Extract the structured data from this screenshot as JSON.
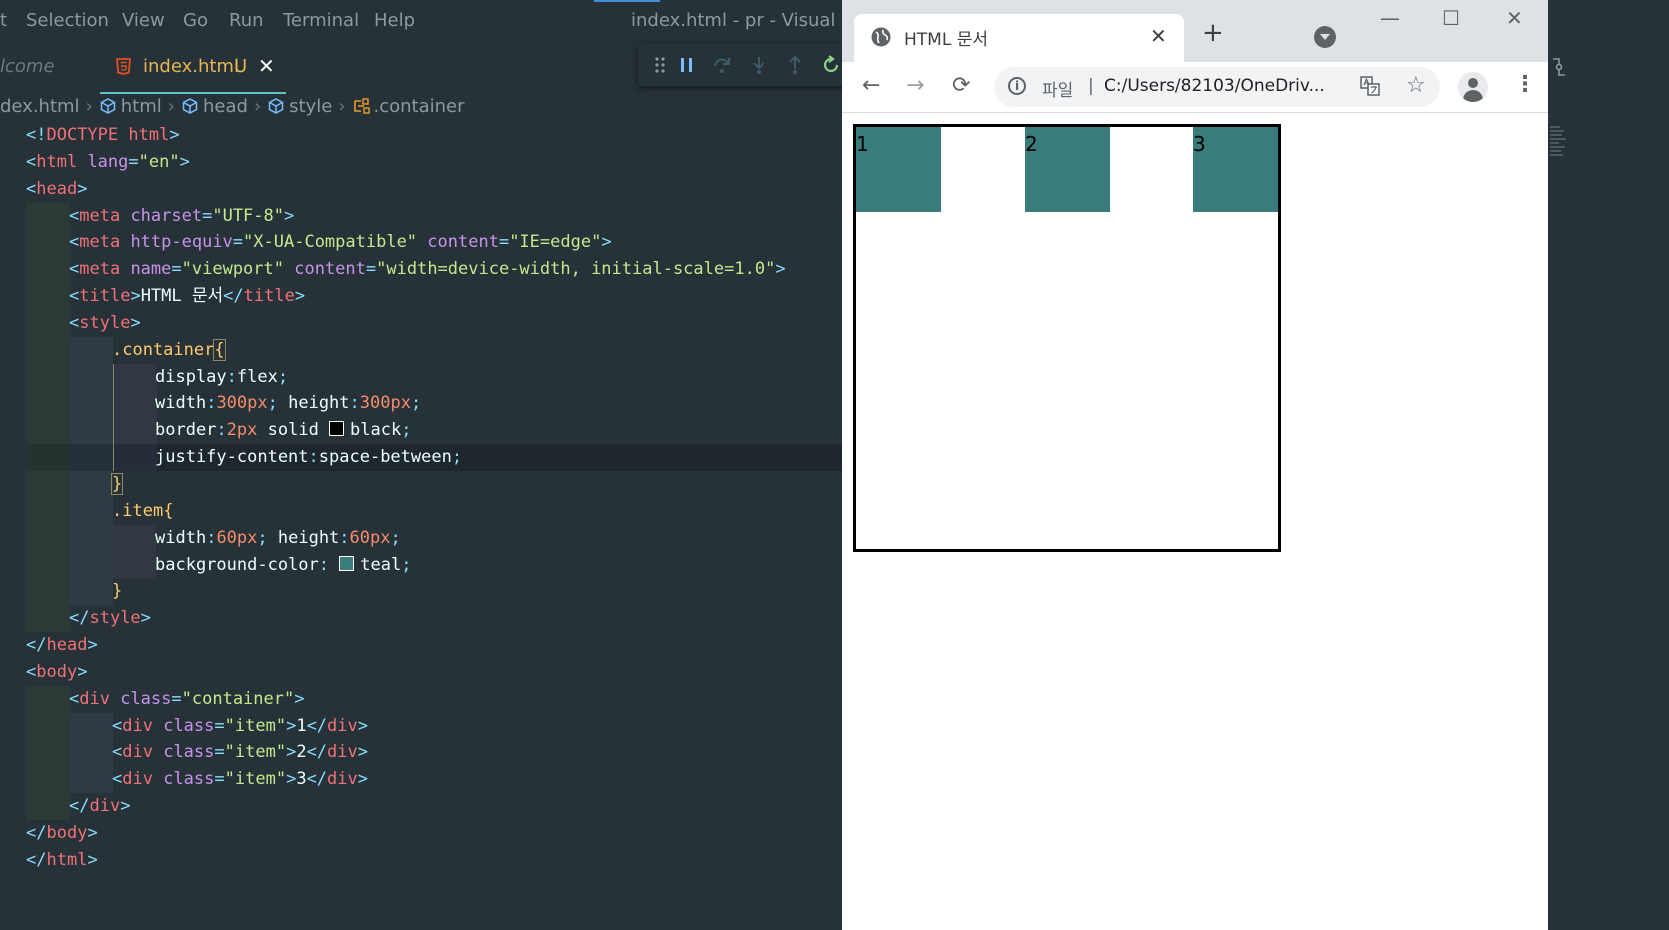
{
  "vscode": {
    "menu": [
      "t",
      "Selection",
      "View",
      "Go",
      "Run",
      "Terminal",
      "Help"
    ],
    "window_title": "index.html - pr - Visual Studi",
    "tabs": {
      "welcome": "lcome",
      "active": "index.html",
      "active_status": "U",
      "close": "✕"
    },
    "breadcrumb": [
      "dex.html",
      "html",
      "head",
      "style",
      ".container"
    ],
    "debug_icons": [
      "drag-handle-icon",
      "pause-icon",
      "step-over-icon",
      "step-into-icon",
      "step-out-icon",
      "restart-icon"
    ],
    "code": {
      "l1": {
        "a": "<!",
        "b": "DOCTYPE",
        "c": " html",
        "d": ">"
      },
      "l2": {
        "a": "<",
        "b": "html",
        "c": " lang",
        "d": "=",
        "e": "\"en\"",
        "f": ">"
      },
      "l3": {
        "a": "<",
        "b": "head",
        "c": ">"
      },
      "l4": {
        "a": "<",
        "b": "meta",
        "c": " charset",
        "d": "=",
        "e": "\"UTF-8\"",
        "f": ">"
      },
      "l5": {
        "a": "<",
        "b": "meta",
        "c": " http-equiv",
        "d": "=",
        "e": "\"X-UA-Compatible\"",
        "f": " content",
        "g": "=",
        "h": "\"IE=edge\"",
        "i": ">"
      },
      "l6": {
        "a": "<",
        "b": "meta",
        "c": " name",
        "d": "=",
        "e": "\"viewport\"",
        "f": " content",
        "g": "=",
        "h": "\"width=device-width, initial-scale=1.0\"",
        "i": ">"
      },
      "l7": {
        "a": "<",
        "b": "title",
        "c": ">",
        "d": "HTML 문서",
        "e": "</",
        "f": "title",
        "g": ">"
      },
      "l8": {
        "a": "<",
        "b": "style",
        "c": ">"
      },
      "l9": {
        "a": ".container",
        "b": "{"
      },
      "l10": {
        "a": "display",
        "b": ":",
        "c": "flex",
        "d": ";"
      },
      "l11": {
        "a": "width",
        "b": ":",
        "c": "300px",
        "d": "; ",
        "e": "height",
        "f": ":",
        "g": "300px",
        "h": ";"
      },
      "l12": {
        "a": "border",
        "b": ":",
        "c": "2px",
        "d": " solid ",
        "e": "black",
        "f": ";"
      },
      "l13": {
        "a": "justify-content",
        "b": ":",
        "c": "space-between",
        "d": ";"
      },
      "l14": {
        "a": "}"
      },
      "l15": {
        "a": ".item",
        "b": "{"
      },
      "l16": {
        "a": "width",
        "b": ":",
        "c": "60px",
        "d": "; ",
        "e": "height",
        "f": ":",
        "g": "60px",
        "h": ";"
      },
      "l17": {
        "a": "background-color",
        "b": ": ",
        "c": "teal",
        "d": ";"
      },
      "l18": {
        "a": "}"
      },
      "l19": {
        "a": "</",
        "b": "style",
        "c": ">"
      },
      "l20": {
        "a": "</",
        "b": "head",
        "c": ">"
      },
      "l21": {
        "a": "<",
        "b": "body",
        "c": ">"
      },
      "l22": {
        "a": "<",
        "b": "div",
        "c": " class",
        "d": "=",
        "e": "\"container\"",
        "f": ">"
      },
      "l23": {
        "a": "<",
        "b": "div",
        "c": " class",
        "d": "=",
        "e": "\"item\"",
        "f": ">",
        "g": "1",
        "h": "</",
        "i": "div",
        "j": ">"
      },
      "l24": {
        "a": "<",
        "b": "div",
        "c": " class",
        "d": "=",
        "e": "\"item\"",
        "f": ">",
        "g": "2",
        "h": "</",
        "i": "div",
        "j": ">"
      },
      "l25": {
        "a": "<",
        "b": "div",
        "c": " class",
        "d": "=",
        "e": "\"item\"",
        "f": ">",
        "g": "3",
        "h": "</",
        "i": "div",
        "j": ">"
      },
      "l26": {
        "a": "</",
        "b": "div",
        "c": ">"
      },
      "l27": {
        "a": "</",
        "b": "body",
        "c": ">"
      },
      "l28": {
        "a": "</",
        "b": "html",
        "c": ">"
      }
    },
    "colors": {
      "bg": "#263238",
      "tag": "#f07178",
      "attr": "#c792ea",
      "string": "#c3e88d",
      "number": "#f78c6c",
      "teal_swatch": "#008080",
      "black_swatch": "#000000"
    }
  },
  "browser": {
    "tab_title": "HTML 문서",
    "tab_close": "✕",
    "new_tab": "+",
    "window_controls": {
      "minimize": "—",
      "maximize": "☐",
      "close": "✕"
    },
    "back": "←",
    "forward": "→",
    "reload": "⟳",
    "info": "i",
    "scheme_label": "파일",
    "separator": "|",
    "url": "C:/Users/82103/OneDriv...",
    "star": "☆",
    "menu": "⋮",
    "items": [
      "1",
      "2",
      "3"
    ],
    "item_color": "#3a7c7c"
  }
}
